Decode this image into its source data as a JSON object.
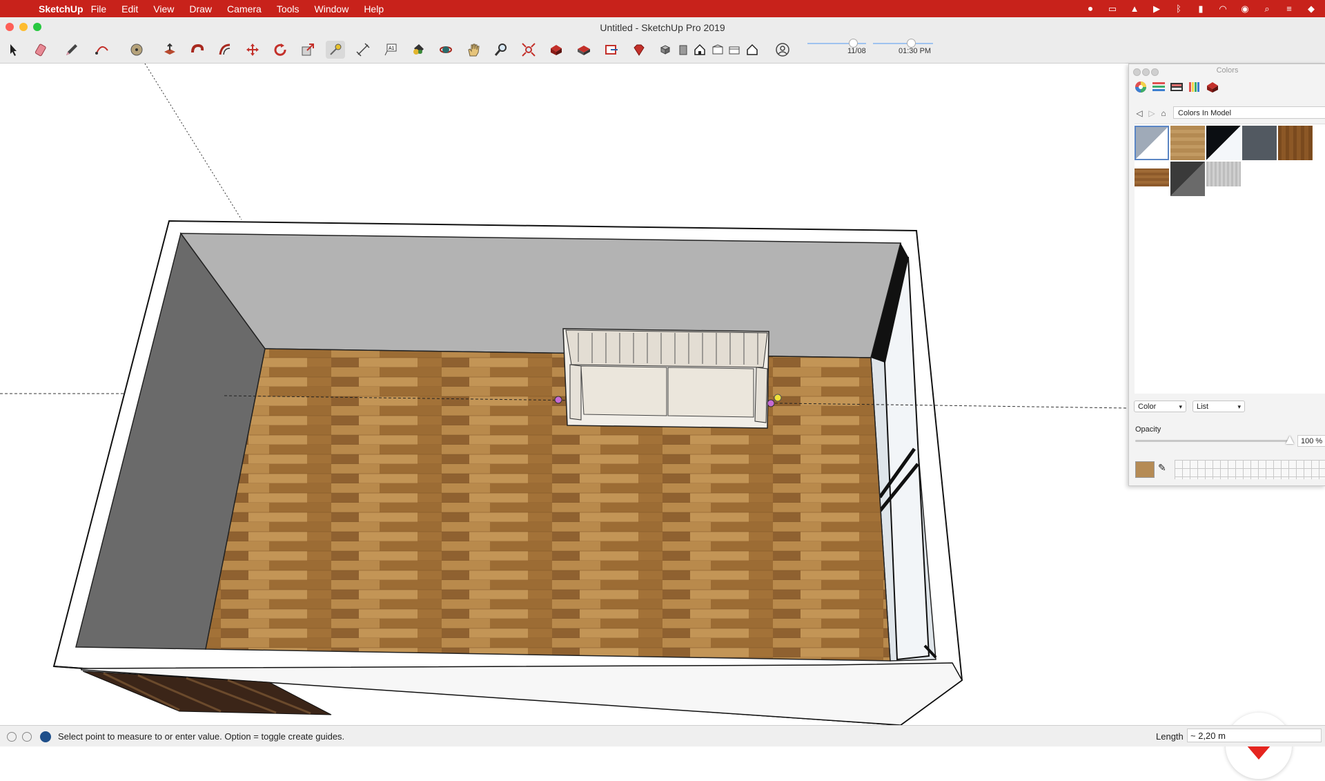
{
  "menubar": {
    "app_name": "SketchUp",
    "items": [
      "File",
      "Edit",
      "View",
      "Draw",
      "Camera",
      "Tools",
      "Window",
      "Help"
    ]
  },
  "window": {
    "title": "Untitled - SketchUp Pro 2019"
  },
  "toolbar": {
    "tools": [
      "select",
      "eraser",
      "pencil",
      "arc",
      "shapes",
      "push-pull",
      "follow-me",
      "offset",
      "move",
      "rotate",
      "scale",
      "tape-measure",
      "dimension",
      "text",
      "paint-bucket",
      "orbit",
      "pan",
      "zoom",
      "zoom-extents",
      "warehouse",
      "extension-warehouse",
      "layout",
      "styles",
      "iso",
      "top",
      "front",
      "right",
      "back",
      "left",
      "account"
    ],
    "shadow_date": "11/08",
    "shadow_time": "01:30 PM",
    "shadow_date_fraction": 0.76,
    "shadow_time_fraction": 0.62
  },
  "colors_panel": {
    "title": "Colors",
    "collection": "Colors In Model",
    "color_mode": "Color",
    "view_mode": "List",
    "opacity_label": "Opacity",
    "opacity_value": "100 %",
    "opacity_fraction": 1.0,
    "swatches": [
      "default",
      "wood-light",
      "black",
      "slate-gray",
      "wood-dark",
      "wood-medium",
      "dark-gray",
      "glass-gray"
    ]
  },
  "statusbar": {
    "message": "Select point to measure to or enter value.  Option = toggle create guides.",
    "length_label": "Length",
    "length_value": "~ 2,20 m"
  },
  "colors": {
    "menubar": "#c8221b",
    "wall_dark": "#6a6a6a",
    "wall_back": "#b3b3b3",
    "floor": "#a87a3f"
  }
}
